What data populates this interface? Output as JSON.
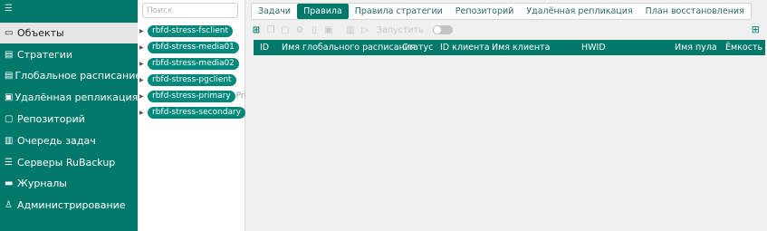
{
  "sidebar": {
    "items": [
      {
        "label": "Объекты",
        "icon": "monitor-icon",
        "glyph": "▭"
      },
      {
        "label": "Стратегии",
        "icon": "list-icon",
        "glyph": "▤"
      },
      {
        "label": "Глобальное расписание",
        "icon": "list-icon",
        "glyph": "▤"
      },
      {
        "label": "Удалённая репликация",
        "icon": "replication-icon",
        "glyph": "▣"
      },
      {
        "label": "Репозиторий",
        "icon": "repository-icon",
        "glyph": "▢"
      },
      {
        "label": "Очередь задач",
        "icon": "clipboard-icon",
        "glyph": "▥"
      },
      {
        "label": "Серверы RuBackup",
        "icon": "server-icon",
        "glyph": "☰"
      },
      {
        "label": "Журналы",
        "icon": "log-icon",
        "glyph": "▬"
      },
      {
        "label": "Администрирование",
        "icon": "users-icon",
        "glyph": "♙"
      }
    ]
  },
  "tree": {
    "search_placeholder": "Поиск",
    "nodes": [
      {
        "label": "rbfd-stress-fsclient"
      },
      {
        "label": "rbfd-stress-media01"
      },
      {
        "label": "rbfd-stress-media02"
      },
      {
        "label": "rbfd-stress-pgclient"
      },
      {
        "label": "rbfd-stress-primary",
        "extra": "Prim"
      },
      {
        "label": "rbfd-stress-secondary"
      }
    ]
  },
  "tabs": [
    "Задачи",
    "Правила",
    "Правила стратегии",
    "Репозиторий",
    "Удалённая репликация",
    "План восстановления"
  ],
  "toolbar": {
    "run_label": "Запустить"
  },
  "table": {
    "columns": [
      "ID",
      "Имя глобального расписания",
      "Статус",
      "ID клиента",
      "Имя клиента",
      "HWID",
      "Имя пула",
      "Ёмкость"
    ]
  },
  "colors": {
    "accent": "#00796b",
    "pill": "#00897b"
  }
}
